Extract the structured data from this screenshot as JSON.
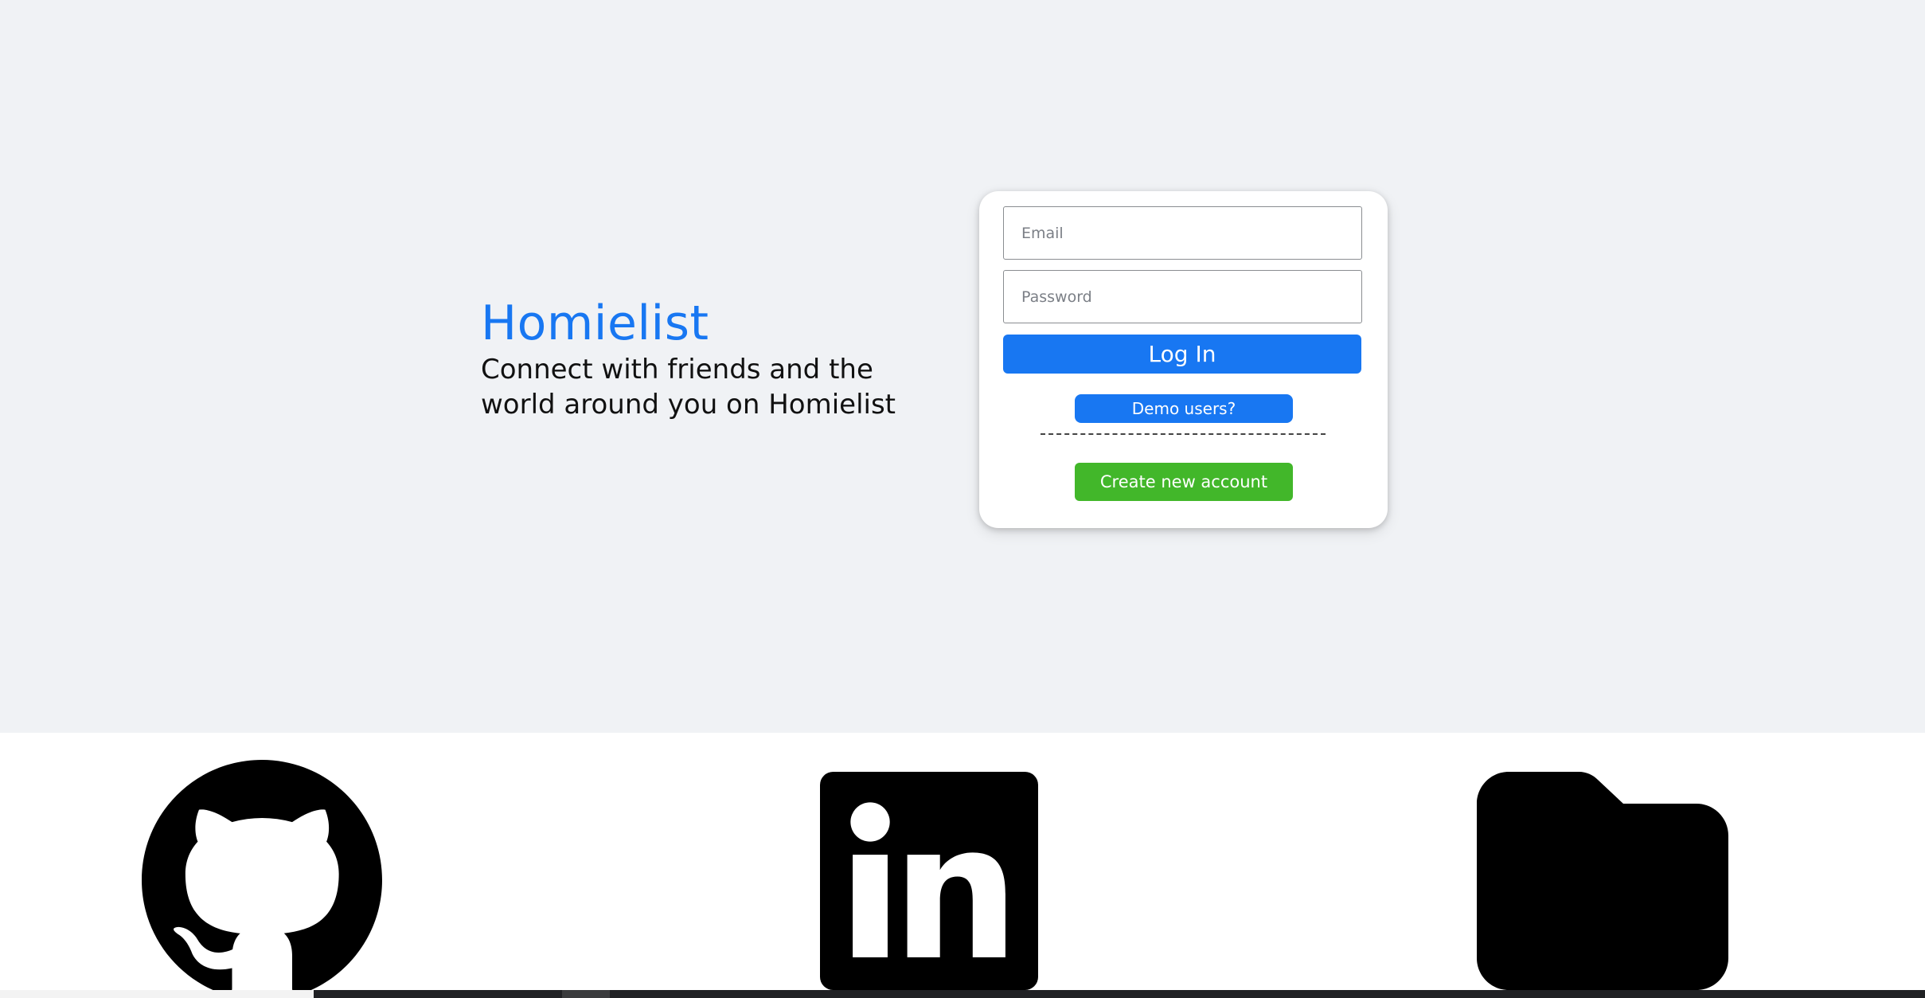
{
  "brand": {
    "title": "Homielist",
    "tagline": "Connect with friends and the world around you on Homielist"
  },
  "login_form": {
    "email_placeholder": "Email",
    "password_placeholder": "Password",
    "login_label": "Log In",
    "demo_label": "Demo users?",
    "create_label": "Create new account"
  },
  "footer": {
    "links": [
      {
        "icon": "github-icon"
      },
      {
        "icon": "linkedin-icon"
      },
      {
        "icon": "folder-icon"
      }
    ]
  },
  "colors": {
    "accent": "#1877f2",
    "success": "#42b72a",
    "background": "#f0f2f5"
  }
}
